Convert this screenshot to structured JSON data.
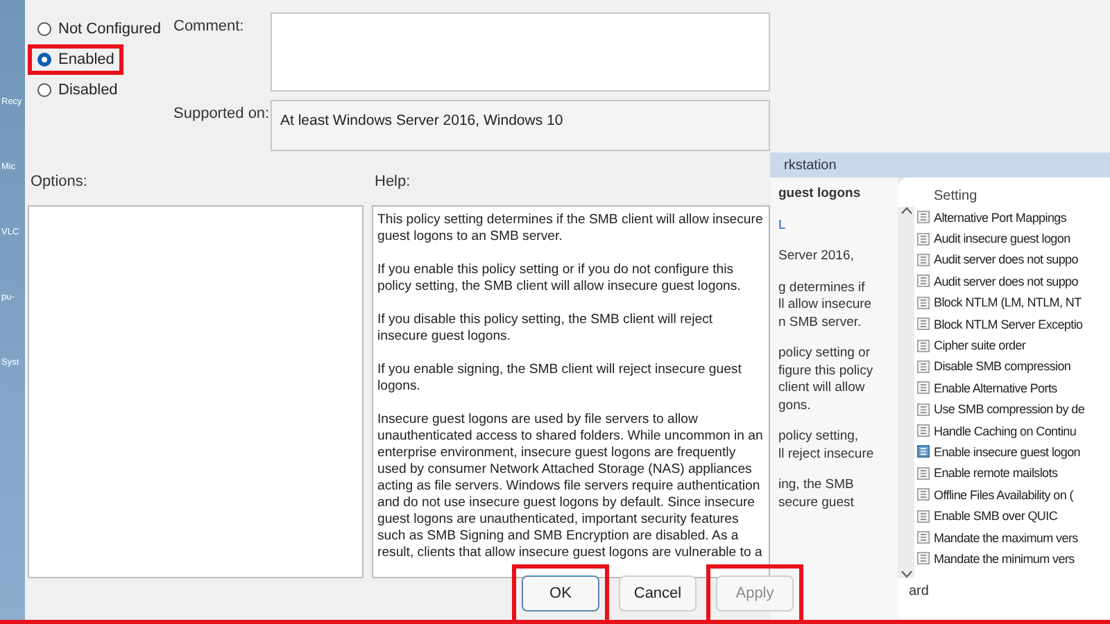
{
  "desktop": {
    "labels": [
      "Recy",
      "Mic",
      "VLC",
      "pu-",
      "Syst"
    ]
  },
  "dialog": {
    "state_options": [
      {
        "label": "Not Configured",
        "selected": false,
        "highlighted": false
      },
      {
        "label": "Enabled",
        "selected": true,
        "highlighted": true
      },
      {
        "label": "Disabled",
        "selected": false,
        "highlighted": false
      }
    ],
    "comment": {
      "label": "Comment:"
    },
    "supported_on": {
      "label": "Supported on:",
      "value": "At least Windows Server 2016, Windows 10"
    },
    "options_label": "Options:",
    "help_label": "Help:",
    "help_paragraphs": [
      "This policy setting determines if the SMB client will allow insecure guest logons to an SMB server.",
      "If you enable this policy setting or if you do not configure this policy setting, the SMB client will allow insecure guest logons.",
      "If you disable this policy setting, the SMB client will reject insecure guest logons.",
      "If you enable signing, the SMB client will reject insecure guest logons.",
      "Insecure guest logons are used by file servers to allow unauthenticated access to shared folders. While uncommon in an enterprise environment, insecure guest logons are frequently used by consumer Network Attached Storage (NAS) appliances acting as file servers. Windows file servers require authentication and do not use insecure guest logons by default. Since insecure guest logons are unauthenticated, important security features such as SMB Signing and SMB Encryption are disabled. As a result, clients that allow insecure guest logons are vulnerable to a"
    ],
    "buttons": [
      {
        "label": "OK",
        "default": true,
        "disabled": false,
        "highlighted": true
      },
      {
        "label": "Cancel",
        "default": false,
        "disabled": false,
        "highlighted": false
      },
      {
        "label": "Apply",
        "default": false,
        "disabled": true,
        "highlighted": true
      }
    ]
  },
  "background_window": {
    "header": "rkstation",
    "detail_blocks": [
      {
        "kind": "title",
        "lines": [
          "guest logons"
        ]
      },
      {
        "kind": "link",
        "lines": [
          "L"
        ]
      },
      {
        "kind": "text",
        "lines": [
          "Server 2016,"
        ]
      },
      {
        "kind": "text",
        "lines": [
          "g determines if",
          "ll allow insecure",
          "n SMB server."
        ]
      },
      {
        "kind": "text",
        "lines": [
          "policy setting or",
          "figure this policy",
          "client will allow",
          "gons."
        ]
      },
      {
        "kind": "text",
        "lines": [
          "policy setting,",
          "ll reject insecure"
        ]
      },
      {
        "kind": "text",
        "lines": [
          "ing, the SMB",
          "secure guest"
        ]
      }
    ],
    "column_header": "Setting",
    "settings": [
      {
        "label": "Alternative Port Mappings",
        "selected": false
      },
      {
        "label": "Audit insecure guest logon",
        "selected": false
      },
      {
        "label": "Audit server does not suppo",
        "selected": false
      },
      {
        "label": "Audit server does not suppo",
        "selected": false
      },
      {
        "label": "Block NTLM (LM, NTLM, NT",
        "selected": false
      },
      {
        "label": "Block NTLM Server Exceptio",
        "selected": false
      },
      {
        "label": "Cipher suite order",
        "selected": false
      },
      {
        "label": "Disable SMB compression",
        "selected": false
      },
      {
        "label": "Enable Alternative Ports",
        "selected": false
      },
      {
        "label": "Use SMB compression by de",
        "selected": false
      },
      {
        "label": "Handle Caching on Continu",
        "selected": false
      },
      {
        "label": "Enable insecure guest logon",
        "selected": true
      },
      {
        "label": "Enable remote mailslots",
        "selected": false
      },
      {
        "label": "Offline Files Availability on (",
        "selected": false
      },
      {
        "label": "Enable SMB over QUIC",
        "selected": false
      },
      {
        "label": "Mandate the maximum vers",
        "selected": false
      },
      {
        "label": "Mandate the minimum vers",
        "selected": false
      }
    ],
    "tab": "ard"
  }
}
